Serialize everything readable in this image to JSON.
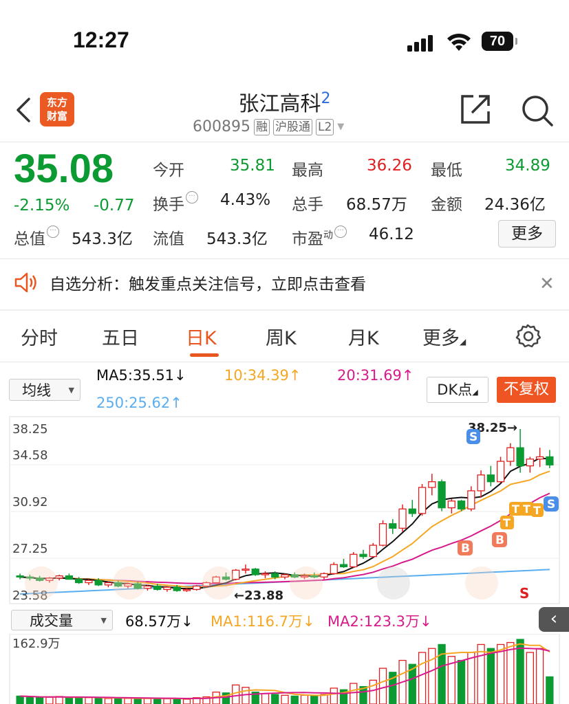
{
  "status": {
    "time": "12:27",
    "battery": "70"
  },
  "header": {
    "logo_line1": "东方",
    "logo_line2": "财富",
    "name": "张江高科",
    "level": "2",
    "code": "600895",
    "tags": [
      "融",
      "沪股通",
      "L2"
    ]
  },
  "quote": {
    "price": "35.08",
    "change_pct": "-2.15%",
    "change": "-0.77",
    "open_label": "今开",
    "open": "35.81",
    "high_label": "最高",
    "high": "36.26",
    "low_label": "最低",
    "low": "34.89",
    "turnover_label": "换手",
    "turnover": "4.43%",
    "volume_label": "总手",
    "volume": "68.57万",
    "amount_label": "金额",
    "amount": "24.36亿",
    "total_cap_label": "总值",
    "total_cap": "543.3亿",
    "float_cap_label": "流值",
    "float_cap": "543.3亿",
    "pe_label": "市盈",
    "pe_sup": "动",
    "pe": "46.12",
    "more": "更多"
  },
  "alert": {
    "text": "自选分析：触发重点关注信号，立即点击查看"
  },
  "tabs": [
    "分时",
    "五日",
    "日K",
    "周K",
    "月K",
    "更多"
  ],
  "ma_bar": {
    "select": "均线",
    "ma5": "MA5:35.51↓",
    "ma10": "10:34.39↑",
    "ma20": "20:31.69↑",
    "ma250": "250:25.62↑",
    "dk": "DK点",
    "fq": "不复权"
  },
  "colors": {
    "up": "#e02020",
    "down": "#0c9a32",
    "accent": "#e8561f",
    "ma5": "#111111",
    "ma10": "#f5a623",
    "ma20": "#d81b8a",
    "ma250": "#5aaef0"
  },
  "kline": {
    "y_labels": [
      "38.25",
      "34.58",
      "30.92",
      "27.25",
      "23.58"
    ],
    "high_label": "38.25→",
    "low_label": "←23.88",
    "signal_s": "S",
    "signal_b": "B",
    "signal_t": "T"
  },
  "volume_bar": {
    "select": "成交量",
    "vol": "68.57万↓",
    "ma1": "MA1:116.7万↓",
    "ma2": "MA2:123.3万↓",
    "max_label": "162.9万"
  },
  "chart_data": {
    "type": "candlestick",
    "ylim": [
      23.58,
      38.25
    ],
    "ohlc": [
      [
        25.3,
        25.5,
        25.0,
        25.2
      ],
      [
        25.2,
        25.4,
        24.9,
        25.1
      ],
      [
        25.1,
        25.3,
        24.8,
        24.9
      ],
      [
        24.9,
        25.2,
        24.7,
        25.1
      ],
      [
        25.1,
        25.4,
        24.9,
        25.3
      ],
      [
        25.3,
        25.5,
        25.0,
        25.0
      ],
      [
        25.0,
        25.2,
        24.6,
        24.7
      ],
      [
        24.7,
        25.0,
        24.5,
        24.9
      ],
      [
        24.9,
        25.1,
        24.4,
        24.5
      ],
      [
        24.5,
        24.8,
        24.3,
        24.7
      ],
      [
        24.7,
        24.9,
        24.3,
        24.4
      ],
      [
        24.4,
        24.7,
        24.2,
        24.6
      ],
      [
        24.6,
        24.8,
        24.1,
        24.2
      ],
      [
        24.2,
        24.5,
        24.0,
        24.4
      ],
      [
        24.4,
        24.6,
        24.0,
        24.1
      ],
      [
        24.1,
        24.4,
        23.9,
        24.3
      ],
      [
        24.3,
        24.5,
        23.9,
        24.0
      ],
      [
        24.0,
        24.2,
        23.88,
        24.1
      ],
      [
        24.1,
        24.5,
        24.0,
        24.4
      ],
      [
        24.4,
        24.8,
        24.3,
        24.7
      ],
      [
        24.7,
        25.3,
        24.6,
        25.2
      ],
      [
        25.2,
        25.6,
        24.9,
        25.0
      ],
      [
        25.0,
        25.9,
        24.9,
        25.8
      ],
      [
        25.8,
        26.3,
        25.5,
        25.9
      ],
      [
        25.9,
        26.0,
        25.3,
        25.4
      ],
      [
        25.4,
        25.7,
        25.1,
        25.5
      ],
      [
        25.5,
        25.7,
        25.0,
        25.2
      ],
      [
        25.2,
        25.5,
        25.0,
        25.4
      ],
      [
        25.4,
        25.6,
        25.1,
        25.2
      ],
      [
        25.2,
        25.5,
        25.0,
        25.3
      ],
      [
        25.3,
        25.6,
        25.1,
        25.2
      ],
      [
        25.2,
        25.6,
        25.0,
        25.5
      ],
      [
        25.5,
        26.5,
        25.4,
        26.3
      ],
      [
        26.3,
        26.8,
        26.0,
        26.1
      ],
      [
        26.1,
        27.4,
        26.0,
        27.2
      ],
      [
        27.2,
        27.6,
        26.8,
        27.0
      ],
      [
        27.0,
        28.2,
        26.9,
        28.0
      ],
      [
        28.0,
        30.2,
        27.9,
        29.9
      ],
      [
        29.9,
        30.3,
        29.0,
        29.5
      ],
      [
        29.5,
        31.6,
        29.2,
        31.2
      ],
      [
        31.2,
        32.0,
        30.5,
        30.8
      ],
      [
        30.8,
        33.4,
        30.6,
        33.1
      ],
      [
        33.1,
        34.3,
        32.4,
        33.6
      ],
      [
        33.6,
        33.8,
        31.0,
        31.3
      ],
      [
        31.3,
        32.1,
        30.8,
        31.9
      ],
      [
        31.9,
        32.0,
        31.0,
        31.2
      ],
      [
        31.2,
        33.2,
        31.0,
        32.8
      ],
      [
        32.8,
        34.6,
        32.2,
        34.2
      ],
      [
        34.2,
        35.0,
        33.2,
        33.6
      ],
      [
        33.6,
        35.8,
        33.5,
        35.4
      ],
      [
        35.4,
        37.0,
        35.0,
        36.6
      ],
      [
        36.6,
        38.25,
        34.4,
        35.0
      ],
      [
        35.0,
        35.8,
        34.4,
        35.6
      ],
      [
        35.6,
        36.6,
        34.9,
        35.8
      ],
      [
        35.8,
        36.4,
        34.8,
        35.08
      ]
    ],
    "volume": [
      20,
      18,
      16,
      17,
      19,
      15,
      17,
      16,
      15,
      14,
      15,
      14,
      13,
      14,
      15,
      13,
      14,
      12,
      16,
      18,
      30,
      28,
      48,
      42,
      30,
      26,
      24,
      22,
      20,
      22,
      21,
      24,
      40,
      36,
      52,
      44,
      60,
      90,
      80,
      110,
      100,
      130,
      140,
      150,
      120,
      110,
      130,
      150,
      140,
      150,
      155,
      162.9,
      130,
      140,
      68.57
    ]
  }
}
